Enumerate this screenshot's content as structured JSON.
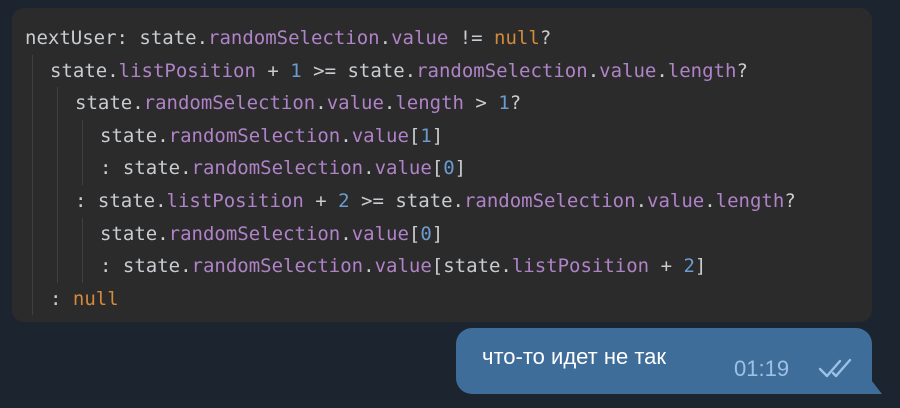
{
  "code_block": {
    "lines": [
      [
        [
          "plain",
          "nextUser: state."
        ],
        [
          "field",
          "randomSelection"
        ],
        [
          "plain",
          "."
        ],
        [
          "field",
          "value"
        ],
        [
          "plain",
          " != "
        ],
        [
          "keyword",
          "null"
        ],
        [
          "plain",
          "?"
        ]
      ],
      [
        [
          "plain",
          "state."
        ],
        [
          "field",
          "listPosition"
        ],
        [
          "plain",
          " + "
        ],
        [
          "number",
          "1"
        ],
        [
          "plain",
          " >= state."
        ],
        [
          "field",
          "randomSelection"
        ],
        [
          "plain",
          "."
        ],
        [
          "field",
          "value"
        ],
        [
          "plain",
          "."
        ],
        [
          "field",
          "length"
        ],
        [
          "plain",
          "?"
        ]
      ],
      [
        [
          "plain",
          "state."
        ],
        [
          "field",
          "randomSelection"
        ],
        [
          "plain",
          "."
        ],
        [
          "field",
          "value"
        ],
        [
          "plain",
          "."
        ],
        [
          "field",
          "length"
        ],
        [
          "plain",
          " > "
        ],
        [
          "number",
          "1"
        ],
        [
          "plain",
          "?"
        ]
      ],
      [
        [
          "plain",
          "state."
        ],
        [
          "field",
          "randomSelection"
        ],
        [
          "plain",
          "."
        ],
        [
          "field",
          "value"
        ],
        [
          "plain",
          "["
        ],
        [
          "number",
          "1"
        ],
        [
          "plain",
          "]"
        ]
      ],
      [
        [
          "plain",
          ": state."
        ],
        [
          "field",
          "randomSelection"
        ],
        [
          "plain",
          "."
        ],
        [
          "field",
          "value"
        ],
        [
          "plain",
          "["
        ],
        [
          "number",
          "0"
        ],
        [
          "plain",
          "]"
        ]
      ],
      [
        [
          "plain",
          ": state."
        ],
        [
          "field",
          "listPosition"
        ],
        [
          "plain",
          " + "
        ],
        [
          "number",
          "2"
        ],
        [
          "plain",
          " >= state."
        ],
        [
          "field",
          "randomSelection"
        ],
        [
          "plain",
          "."
        ],
        [
          "field",
          "value"
        ],
        [
          "plain",
          "."
        ],
        [
          "field",
          "length"
        ],
        [
          "plain",
          "?"
        ]
      ],
      [
        [
          "plain",
          "state."
        ],
        [
          "field",
          "randomSelection"
        ],
        [
          "plain",
          "."
        ],
        [
          "field",
          "value"
        ],
        [
          "plain",
          "["
        ],
        [
          "number",
          "0"
        ],
        [
          "plain",
          "]"
        ]
      ],
      [
        [
          "plain",
          ": state."
        ],
        [
          "field",
          "randomSelection"
        ],
        [
          "plain",
          "."
        ],
        [
          "field",
          "value"
        ],
        [
          "plain",
          "[state."
        ],
        [
          "field",
          "listPosition"
        ],
        [
          "plain",
          " + "
        ],
        [
          "number",
          "2"
        ],
        [
          "plain",
          "]"
        ]
      ],
      [
        [
          "plain",
          ": "
        ],
        [
          "keyword",
          "null"
        ]
      ]
    ]
  },
  "message": {
    "text": "что-то идет не так",
    "time": "01:19",
    "status_icon": "double-check-icon"
  },
  "colors": {
    "background": "#1c242f",
    "code_background": "#2b2b2b",
    "code_plain": "#c9ccd1",
    "code_field": "#b083c9",
    "code_keyword": "#d48a3a",
    "code_number": "#6b9bd1",
    "bubble": "#3f6d9a",
    "time": "#9cc1e6"
  }
}
